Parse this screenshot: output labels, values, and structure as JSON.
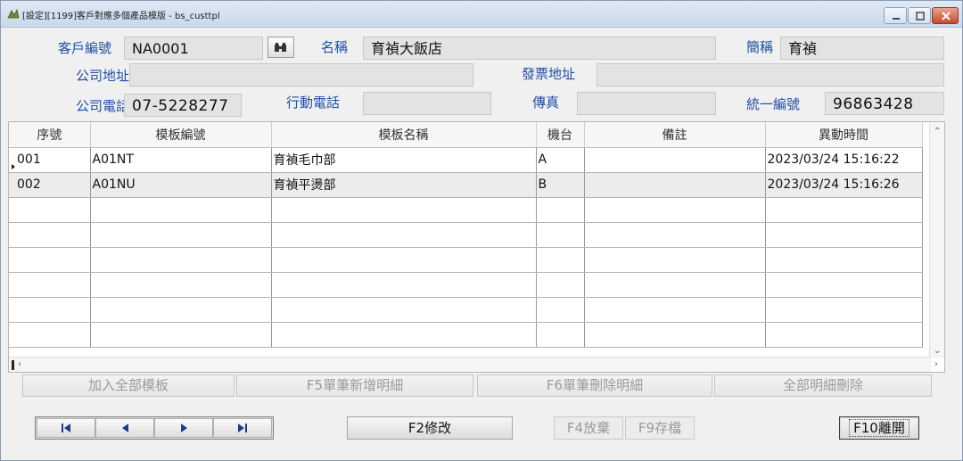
{
  "window": {
    "title": "[設定][1199]客戶對應多個產品模版 - bs_custtpl",
    "min_icon": "minimize-icon",
    "max_icon": "maximize-icon",
    "close_icon": "close-icon"
  },
  "form": {
    "cust_no_label": "客戶編號",
    "cust_no_value": "NA0001",
    "name_label": "名稱",
    "name_value": "育禎大飯店",
    "short_label": "簡稱",
    "short_value": "育禎",
    "company_addr_label": "公司地址",
    "company_addr_value": "",
    "invoice_addr_label": "發票地址",
    "invoice_addr_value": "",
    "company_phone_label": "公司電話",
    "company_phone_value": "07-5228277",
    "mobile_label": "行動電話",
    "mobile_value": "",
    "fax_label": "傳真",
    "fax_value": "",
    "tax_id_label": "統一編號",
    "tax_id_value": "96863428"
  },
  "grid": {
    "columns": [
      "序號",
      "模板編號",
      "模板名稱",
      "機台",
      "備註",
      "異動時間"
    ],
    "rows": [
      [
        "001",
        "A01NT",
        "育禎毛巾部",
        "A",
        "",
        "2023/03/24 15:16:22"
      ],
      [
        "002",
        "A01NU",
        "育禎平燙部",
        "B",
        "",
        "2023/03/24 15:16:26"
      ],
      [
        "",
        "",
        "",
        "",
        "",
        ""
      ],
      [
        "",
        "",
        "",
        "",
        "",
        ""
      ],
      [
        "",
        "",
        "",
        "",
        "",
        ""
      ],
      [
        "",
        "",
        "",
        "",
        "",
        ""
      ],
      [
        "",
        "",
        "",
        "",
        "",
        ""
      ],
      [
        "",
        "",
        "",
        "",
        "",
        ""
      ]
    ]
  },
  "actions": {
    "add_all": "加入全部模板",
    "add_one": "F5單筆新增明細",
    "delete_one": "F6單筆刪除明細",
    "delete_all": "全部明細刪除"
  },
  "footer": {
    "modify": "F2修改",
    "discard": "F4放棄",
    "save": "F9存檔",
    "exit": "F10離開"
  }
}
